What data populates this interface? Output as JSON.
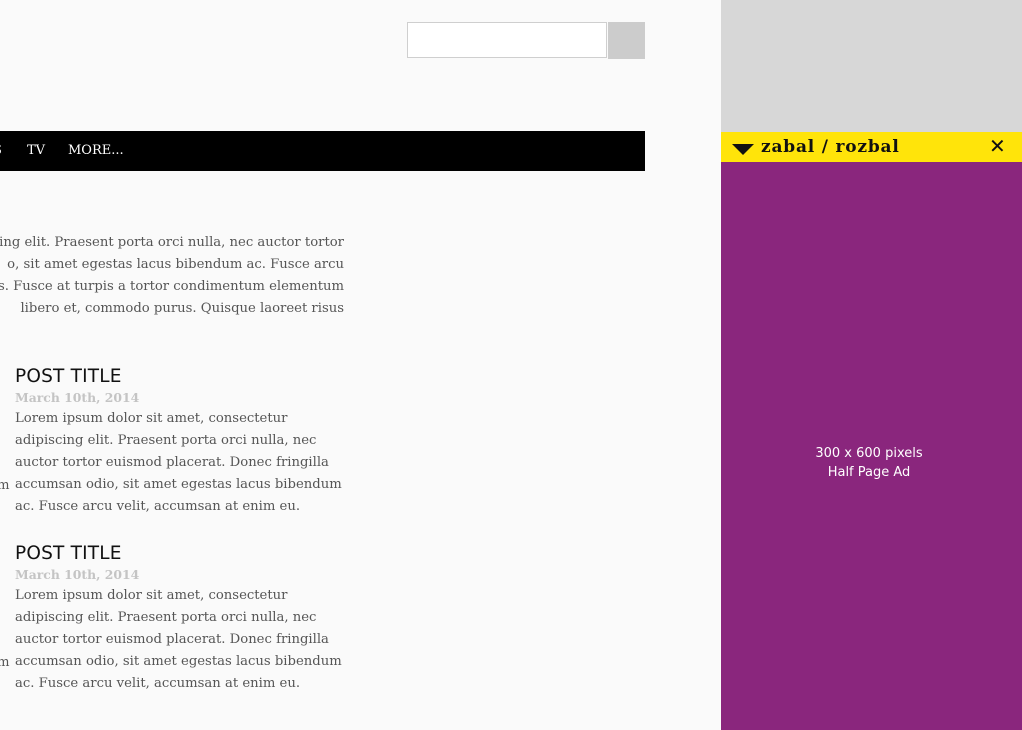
{
  "search": {
    "value": "",
    "placeholder": ""
  },
  "nav": {
    "items": [
      {
        "label": "S"
      },
      {
        "label": "TV"
      },
      {
        "label": "MORE..."
      }
    ]
  },
  "intro": {
    "lines": [
      "cing elit. Praesent porta orci nulla, nec auctor tortor",
      "o, sit amet egestas lacus bibendum ac. Fusce arcu",
      "s. Fusce at turpis a tortor condimentum elementum",
      "libero et, commodo purus. Quisque laoreet risus"
    ]
  },
  "posts": [
    {
      "title": "POST TITLE",
      "date": "March 10th, 2014",
      "lines": [
        "Lorem ipsum dolor sit amet, consectetur",
        "adipiscing elit. Praesent porta orci nulla, nec",
        "auctor tortor euismod placerat. Donec fringilla",
        "accumsan odio, sit amet egestas lacus bibendum",
        "ac. Fusce arcu velit, accumsan at enim eu."
      ],
      "left_stub": "m"
    },
    {
      "title": "POST TITLE",
      "date": "March 10th, 2014",
      "lines": [
        "Lorem ipsum dolor sit amet, consectetur",
        "adipiscing elit. Praesent porta orci nulla, nec",
        "auctor tortor euismod placerat. Donec fringilla",
        "accumsan odio, sit amet egestas lacus bibendum",
        "ac. Fusce arcu velit, accumsan at enim eu."
      ],
      "left_stub": "m"
    }
  ],
  "ad": {
    "toggle_label": "zabal / rozbal",
    "toggle_arrow_icon": "triangle-down-icon",
    "close_icon": "close-icon",
    "close_glyph": "✕",
    "size_text": "300 x 600 pixels",
    "type_text": "Half Page Ad",
    "colors": {
      "top_placeholder": "#d7d7d7",
      "toggle_bar": "#ffe40a",
      "panel": "#8a267d"
    }
  }
}
